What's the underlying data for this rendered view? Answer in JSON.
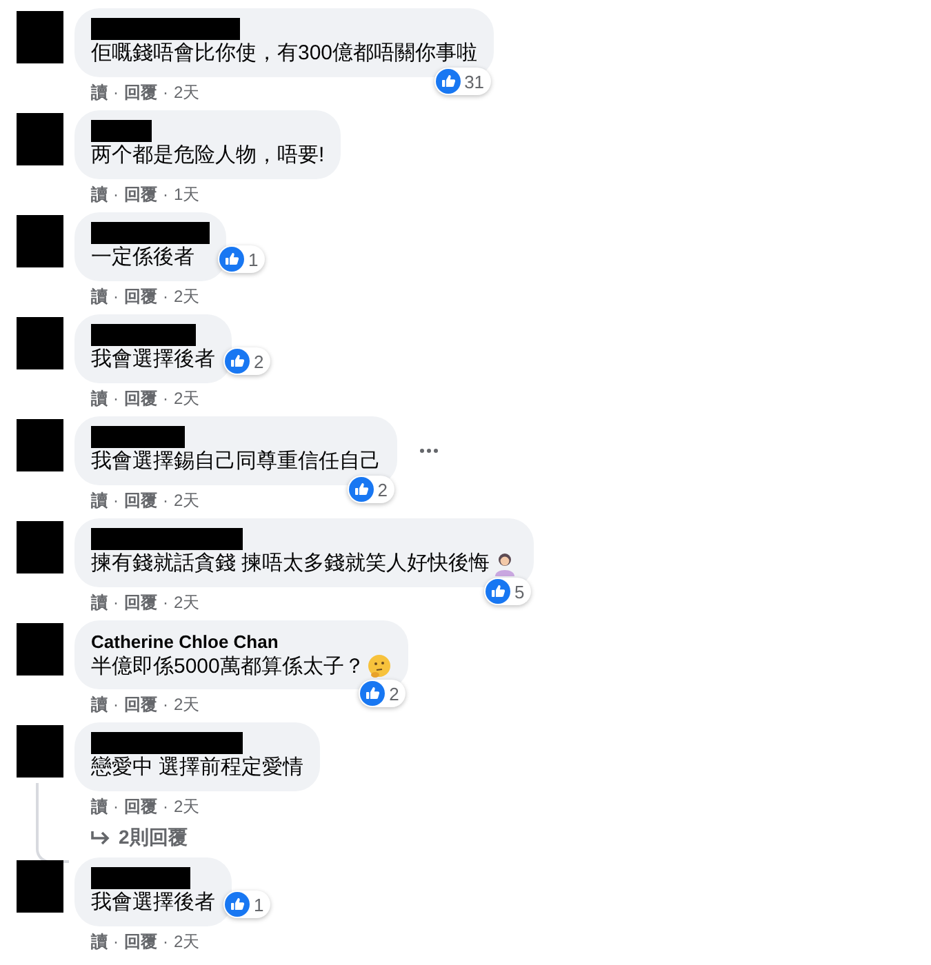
{
  "comments": [
    {
      "author": {
        "redacted": true
      },
      "text": "佢嘅錢唔會比你使，有300億都唔關你事啦",
      "reactions": {
        "count": "31",
        "kind": "corner"
      },
      "meta": [
        {
          "kind": "link",
          "text": "讀"
        },
        {
          "kind": "separator",
          "text": "·"
        },
        {
          "kind": "link",
          "text": "回覆"
        },
        {
          "kind": "separator",
          "text": "·"
        },
        {
          "kind": "time",
          "text": "2天"
        }
      ]
    },
    {
      "author": {
        "redacted": true
      },
      "text": "两个都是危险人物，唔要!",
      "meta": [
        {
          "kind": "link",
          "text": "讀"
        },
        {
          "kind": "separator",
          "text": "·"
        },
        {
          "kind": "link",
          "text": "回覆"
        },
        {
          "kind": "separator",
          "text": "·"
        },
        {
          "kind": "time",
          "text": "1天"
        }
      ]
    },
    {
      "author": {
        "redacted": true
      },
      "text": "一定係後者",
      "reactions": {
        "count": "1",
        "kind": "inline"
      },
      "meta": [
        {
          "kind": "link",
          "text": "讀"
        },
        {
          "kind": "separator",
          "text": "·"
        },
        {
          "kind": "link",
          "text": "回覆"
        },
        {
          "kind": "separator",
          "text": "·"
        },
        {
          "kind": "time",
          "text": "2天"
        }
      ]
    },
    {
      "author": {
        "redacted": true
      },
      "text": "我會選擇後者",
      "reactions": {
        "count": "2",
        "kind": "inline"
      },
      "meta": [
        {
          "kind": "link",
          "text": "讀"
        },
        {
          "kind": "separator",
          "text": "·"
        },
        {
          "kind": "link",
          "text": "回覆"
        },
        {
          "kind": "separator",
          "text": "·"
        },
        {
          "kind": "time",
          "text": "2天"
        }
      ]
    },
    {
      "author": {
        "redacted": true
      },
      "text": "我會選擇錫自己同尊重信任自己",
      "reactions": {
        "count": "2",
        "kind": "corner"
      },
      "more_button": true,
      "meta": [
        {
          "kind": "link",
          "text": "讀"
        },
        {
          "kind": "separator",
          "text": "·"
        },
        {
          "kind": "link",
          "text": "回覆"
        },
        {
          "kind": "separator",
          "text": "·"
        },
        {
          "kind": "time",
          "text": "2天"
        }
      ]
    },
    {
      "author": {
        "redacted": true
      },
      "text": "揀有錢就話貪錢 揀唔太多錢就笑人好快後悔",
      "emoji_icon": {
        "kind": "person"
      },
      "reactions": {
        "count": "5",
        "kind": "corner"
      },
      "meta": [
        {
          "kind": "link",
          "text": "讀"
        },
        {
          "kind": "separator",
          "text": "·"
        },
        {
          "kind": "link",
          "text": "回覆"
        },
        {
          "kind": "separator",
          "text": "·"
        },
        {
          "kind": "time",
          "text": "2天"
        }
      ]
    },
    {
      "author": {
        "redacted": false,
        "name": "Catherine Chloe Chan"
      },
      "text": "半億即係5000萬都算係太子？",
      "emoji_icon": {
        "kind": "thinking"
      },
      "reactions": {
        "count": "2",
        "kind": "corner"
      },
      "meta": [
        {
          "kind": "link",
          "text": "讀"
        },
        {
          "kind": "separator",
          "text": "·"
        },
        {
          "kind": "link",
          "text": "回覆"
        },
        {
          "kind": "separator",
          "text": "·"
        },
        {
          "kind": "time",
          "text": "2天"
        }
      ]
    },
    {
      "author": {
        "redacted": true
      },
      "text": "戀愛中 選擇前程定愛情",
      "meta": [
        {
          "kind": "link",
          "text": "讀"
        },
        {
          "kind": "separator",
          "text": "·"
        },
        {
          "kind": "link",
          "text": "回覆"
        },
        {
          "kind": "separator",
          "text": "·"
        },
        {
          "kind": "time",
          "text": "2天"
        }
      ],
      "replies_link": "2則回覆"
    },
    {
      "author": {
        "redacted": true
      },
      "text": "我會選擇後者",
      "reactions": {
        "count": "1",
        "kind": "inline"
      },
      "meta": [
        {
          "kind": "link",
          "text": "讀"
        },
        {
          "kind": "separator",
          "text": "·"
        },
        {
          "kind": "link",
          "text": "回覆"
        },
        {
          "kind": "separator",
          "text": "·"
        },
        {
          "kind": "time",
          "text": "2天"
        }
      ]
    }
  ]
}
